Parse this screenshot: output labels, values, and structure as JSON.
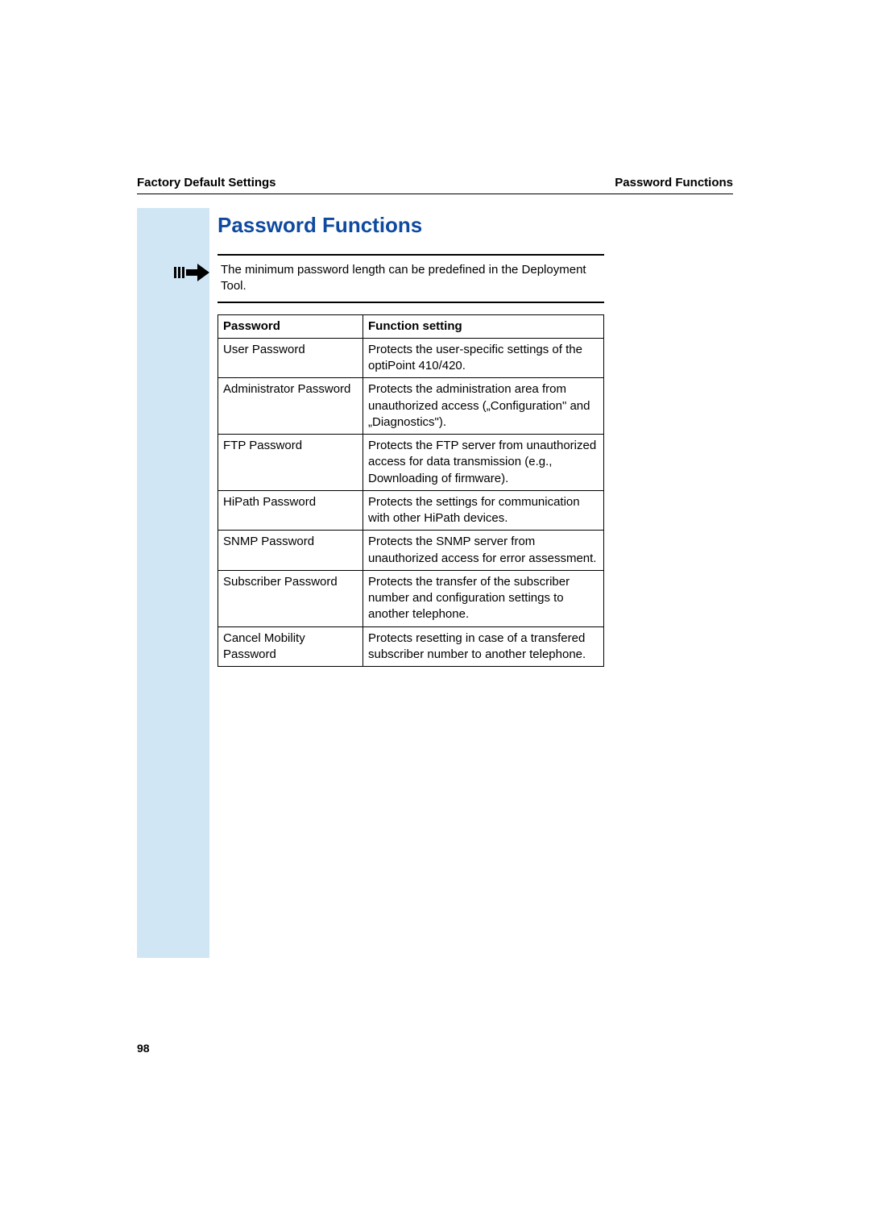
{
  "header": {
    "left": "Factory Default Settings",
    "right": "Password Functions"
  },
  "section_title": "Password Functions",
  "note": "The minimum password length can be predefined in the Deployment Tool.",
  "table": {
    "col1_header": "Password",
    "col2_header": "Function setting",
    "rows": [
      {
        "c1": "User Password",
        "c2": "Protects the user-specific settings of the optiPoint 410/420."
      },
      {
        "c1": "Administrator Password",
        "c2": "Protects the administration area from unauthorized access („Configuration\" and „Diagnostics\")."
      },
      {
        "c1": "FTP Password",
        "c2": "Protects the FTP server from unauthorized access for data transmission (e.g., Downloading of firmware)."
      },
      {
        "c1": "HiPath Password",
        "c2": "Protects the settings for communication with other HiPath devices."
      },
      {
        "c1": "SNMP Password",
        "c2": "Protects the SNMP server from unauthorized access for error assessment."
      },
      {
        "c1": "Subscriber Password",
        "c2": "Protects the transfer of the subscriber number and configuration settings to another telephone."
      },
      {
        "c1": "Cancel Mobility Password",
        "c2": "Protects resetting in case of a transfered subscriber number to another telephone."
      }
    ]
  },
  "page_number": "98"
}
